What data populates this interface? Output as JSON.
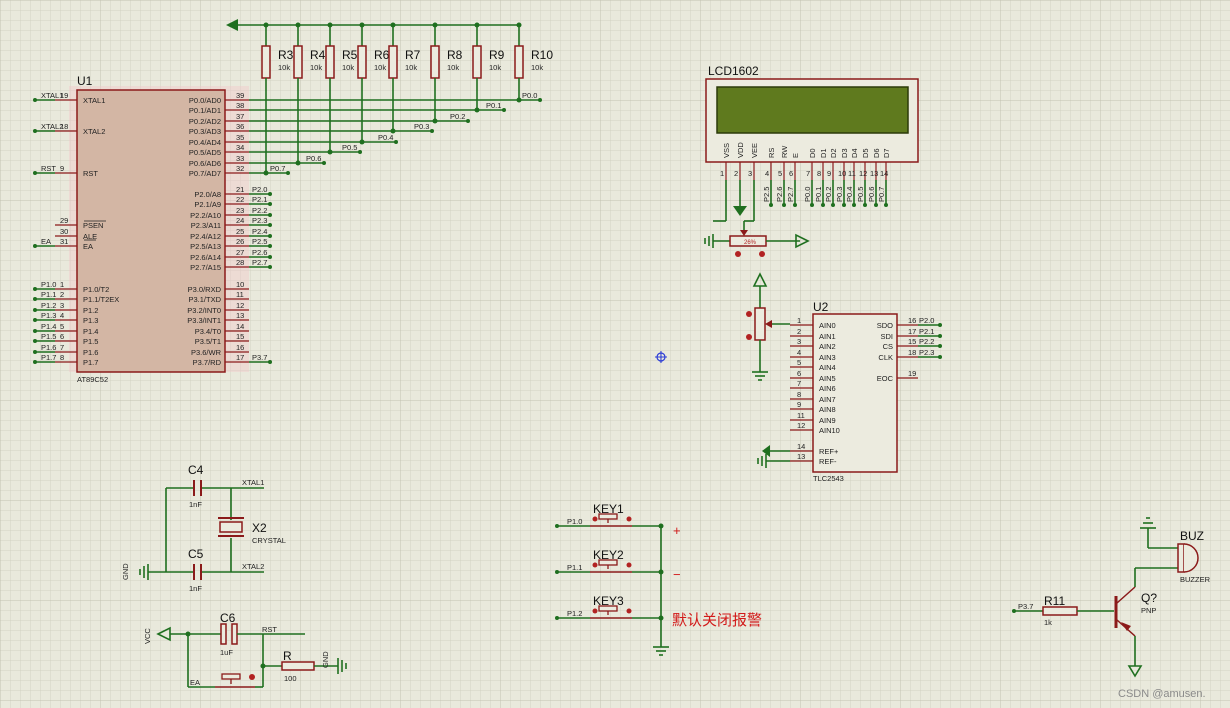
{
  "u1": {
    "ref": "U1",
    "part": "AT89C52",
    "left_pins": [
      {
        "num": "19",
        "name": "XTAL1",
        "net": "XTAL1"
      },
      {
        "num": "18",
        "name": "XTAL2",
        "net": "XTAL2"
      },
      {
        "num": "9",
        "name": "RST",
        "net": "RST"
      },
      {
        "num": "29",
        "name": "PSEN",
        "net": ""
      },
      {
        "num": "30",
        "name": "ALE",
        "net": ""
      },
      {
        "num": "31",
        "name": "EA",
        "net": "EA"
      },
      {
        "num": "1",
        "name": "P1.0/T2",
        "net": "P1.0"
      },
      {
        "num": "2",
        "name": "P1.1/T2EX",
        "net": "P1.1"
      },
      {
        "num": "3",
        "name": "P1.2",
        "net": "P1.2"
      },
      {
        "num": "4",
        "name": "P1.3",
        "net": "P1.3"
      },
      {
        "num": "5",
        "name": "P1.4",
        "net": "P1.4"
      },
      {
        "num": "6",
        "name": "P1.5",
        "net": "P1.5"
      },
      {
        "num": "7",
        "name": "P1.6",
        "net": "P1.6"
      },
      {
        "num": "8",
        "name": "P1.7",
        "net": "P1.7"
      }
    ],
    "right_p0": [
      {
        "num": "39",
        "name": "P0.0/AD0",
        "net": "P0.0"
      },
      {
        "num": "38",
        "name": "P0.1/AD1",
        "net": "P0.1"
      },
      {
        "num": "37",
        "name": "P0.2/AD2",
        "net": "P0.2"
      },
      {
        "num": "36",
        "name": "P0.3/AD3",
        "net": "P0.3"
      },
      {
        "num": "35",
        "name": "P0.4/AD4",
        "net": "P0.4"
      },
      {
        "num": "34",
        "name": "P0.5/AD5",
        "net": "P0.5"
      },
      {
        "num": "33",
        "name": "P0.6/AD6",
        "net": "P0.6"
      },
      {
        "num": "32",
        "name": "P0.7/AD7",
        "net": "P0.7"
      }
    ],
    "right_p2": [
      {
        "num": "21",
        "name": "P2.0/A8",
        "net": "P2.0"
      },
      {
        "num": "22",
        "name": "P2.1/A9",
        "net": "P2.1"
      },
      {
        "num": "23",
        "name": "P2.2/A10",
        "net": "P2.2"
      },
      {
        "num": "24",
        "name": "P2.3/A11",
        "net": "P2.3"
      },
      {
        "num": "25",
        "name": "P2.4/A12",
        "net": "P2.4"
      },
      {
        "num": "26",
        "name": "P2.5/A13",
        "net": "P2.5"
      },
      {
        "num": "27",
        "name": "P2.6/A14",
        "net": "P2.6"
      },
      {
        "num": "28",
        "name": "P2.7/A15",
        "net": "P2.7"
      }
    ],
    "right_p3": [
      {
        "num": "10",
        "name": "P3.0/RXD",
        "net": ""
      },
      {
        "num": "11",
        "name": "P3.1/TXD",
        "net": ""
      },
      {
        "num": "12",
        "name": "P3.2/INT0",
        "net": ""
      },
      {
        "num": "13",
        "name": "P3.3/INT1",
        "net": ""
      },
      {
        "num": "14",
        "name": "P3.4/T0",
        "net": ""
      },
      {
        "num": "15",
        "name": "P3.5/T1",
        "net": ""
      },
      {
        "num": "16",
        "name": "P3.6/WR",
        "net": ""
      },
      {
        "num": "17",
        "name": "P3.7/RD",
        "net": "P3.7"
      }
    ]
  },
  "resistors": [
    {
      "ref": "R3",
      "value": "10k"
    },
    {
      "ref": "R4",
      "value": "10k"
    },
    {
      "ref": "R5",
      "value": "10k"
    },
    {
      "ref": "R6",
      "value": "10k"
    },
    {
      "ref": "R7",
      "value": "10k"
    },
    {
      "ref": "R8",
      "value": "10k"
    },
    {
      "ref": "R9",
      "value": "10k"
    },
    {
      "ref": "R10",
      "value": "10k"
    }
  ],
  "lcd": {
    "ref": "LCD1602",
    "pins": [
      {
        "num": "1",
        "name": "VSS",
        "net": ""
      },
      {
        "num": "2",
        "name": "VDD",
        "net": ""
      },
      {
        "num": "3",
        "name": "VEE",
        "net": ""
      },
      {
        "num": "4",
        "name": "RS",
        "net": "P2.5"
      },
      {
        "num": "5",
        "name": "RW",
        "net": "P2.6"
      },
      {
        "num": "6",
        "name": "E",
        "net": "P2.7"
      },
      {
        "num": "7",
        "name": "D0",
        "net": "P0.0"
      },
      {
        "num": "8",
        "name": "D1",
        "net": "P0.1"
      },
      {
        "num": "9",
        "name": "D2",
        "net": "P0.2"
      },
      {
        "num": "10",
        "name": "D3",
        "net": "P0.3"
      },
      {
        "num": "11",
        "name": "D4",
        "net": "P0.4"
      },
      {
        "num": "12",
        "name": "D5",
        "net": "P0.5"
      },
      {
        "num": "13",
        "name": "D6",
        "net": "P0.6"
      },
      {
        "num": "14",
        "name": "D7",
        "net": "P0.7"
      }
    ],
    "pot_label": "26%"
  },
  "u2": {
    "ref": "U2",
    "part": "TLC2543",
    "left_pins": [
      {
        "num": "1",
        "name": "AIN0"
      },
      {
        "num": "2",
        "name": "AIN1"
      },
      {
        "num": "3",
        "name": "AIN2"
      },
      {
        "num": "4",
        "name": "AIN3"
      },
      {
        "num": "5",
        "name": "AIN4"
      },
      {
        "num": "6",
        "name": "AIN5"
      },
      {
        "num": "7",
        "name": "AIN6"
      },
      {
        "num": "8",
        "name": "AIN7"
      },
      {
        "num": "9",
        "name": "AIN8"
      },
      {
        "num": "11",
        "name": "AIN9"
      },
      {
        "num": "12",
        "name": "AIN10"
      },
      {
        "num": "14",
        "name": "REF+"
      },
      {
        "num": "13",
        "name": "REF-"
      }
    ],
    "right_pins": [
      {
        "num": "16",
        "name": "SDO",
        "net": "P2.0"
      },
      {
        "num": "17",
        "name": "SDI",
        "net": "P2.1"
      },
      {
        "num": "15",
        "name": "CS",
        "net": "P2.2"
      },
      {
        "num": "18",
        "name": "CLK",
        "net": "P2.3"
      },
      {
        "num": "19",
        "name": "EOC",
        "net": ""
      }
    ]
  },
  "osc": {
    "c4": {
      "ref": "C4",
      "value": "1nF"
    },
    "c5": {
      "ref": "C5",
      "value": "1nF"
    },
    "x2": {
      "ref": "X2",
      "value": "CRYSTAL"
    },
    "xtal1": "XTAL1",
    "xtal2": "XTAL2",
    "gnd": "GND"
  },
  "reset": {
    "c6": {
      "ref": "C6",
      "value": "1uF"
    },
    "r": {
      "ref": "R",
      "value": "100"
    },
    "vcc": "VCC",
    "rst": "RST",
    "ea": "EA",
    "gnd": "GND"
  },
  "keys": [
    {
      "ref": "KEY1",
      "net": "P1.0"
    },
    {
      "ref": "KEY2",
      "net": "P1.1"
    },
    {
      "ref": "KEY3",
      "net": "P1.2"
    }
  ],
  "key_plus": "+",
  "key_minus": "−",
  "note": "默认关闭报警",
  "buzzer": {
    "ref": "BUZ",
    "part": "BUZZER",
    "q_ref": "Q?",
    "q_part": "PNP",
    "r_ref": "R11",
    "r_value": "1k",
    "net": "P3.7"
  },
  "watermark": "CSDN @amusen."
}
